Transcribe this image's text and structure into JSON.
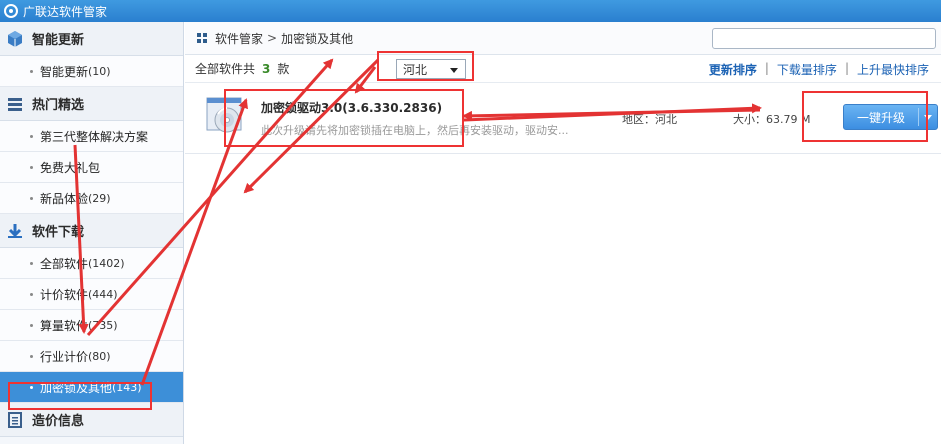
{
  "app": {
    "title": "广联达软件管家"
  },
  "sidebar": {
    "groups": [
      {
        "title": "智能更新",
        "items": [
          {
            "label": "智能更新",
            "count": "(10)"
          }
        ]
      },
      {
        "title": "热门精选",
        "items": [
          {
            "label": "第三代整体解决方案",
            "count": ""
          },
          {
            "label": "免费大礼包",
            "count": ""
          },
          {
            "label": "新品体验",
            "count": "(29)"
          }
        ]
      },
      {
        "title": "软件下载",
        "items": [
          {
            "label": "全部软件",
            "count": "(1402)"
          },
          {
            "label": "计价软件",
            "count": "(444)"
          },
          {
            "label": "算量软件",
            "count": "(735)"
          },
          {
            "label": "行业计价",
            "count": "(80)"
          },
          {
            "label": "加密锁及其他",
            "count": "(143)"
          }
        ]
      },
      {
        "title": "造价信息",
        "items": []
      }
    ]
  },
  "breadcrumb": {
    "root": "软件管家",
    "sep": ">",
    "current": "加密锁及其他"
  },
  "search": {
    "placeholder": "",
    "value": ""
  },
  "filter": {
    "total_prefix": "全部软件共",
    "total_count": "3",
    "total_suffix": "款",
    "region_selected": "河北",
    "sorts": [
      "更新排序",
      "下载量排序",
      "上升最快排序"
    ],
    "sep": "|"
  },
  "software": [
    {
      "name": "加密锁驱动3.0(3.6.330.2836)",
      "desc": "此次升级请先将加密锁插在电脑上，然后再安装驱动，驱动安...",
      "region": "地区：河北",
      "size": "大小：63.79 M",
      "action": "一键升级"
    }
  ],
  "colors": {
    "titlebar": "#2a7fcf",
    "active_item": "#3d8fd8",
    "annotation": "#e33333",
    "link": "#1b62b4",
    "count_green": "#3a8a2a"
  }
}
